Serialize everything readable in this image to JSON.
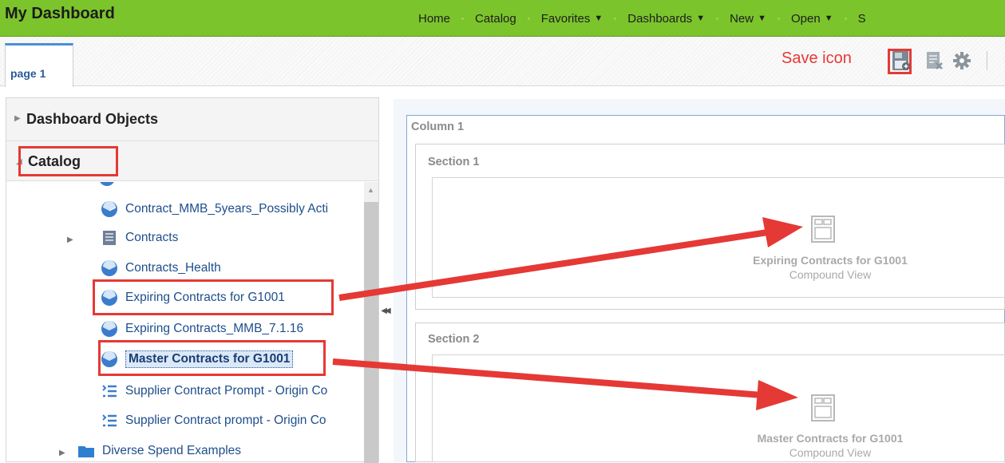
{
  "app": {
    "title": "My Dashboard"
  },
  "nav": [
    {
      "label": "Home",
      "caret": ""
    },
    {
      "label": "Catalog",
      "caret": ""
    },
    {
      "label": "Favorites",
      "caret": "▼"
    },
    {
      "label": "Dashboards",
      "caret": "▼"
    },
    {
      "label": "New",
      "caret": "▼"
    },
    {
      "label": "Open",
      "caret": "▼"
    },
    {
      "label": "S",
      "caret": ""
    }
  ],
  "tabs": [
    {
      "label": "page 1"
    }
  ],
  "annotation": {
    "save_callout": "Save icon"
  },
  "toolbar": {
    "icons": [
      "save-icon",
      "discard-icon",
      "settings-icon"
    ]
  },
  "left_panel": {
    "sections": [
      {
        "label": "Dashboard Objects",
        "expanded": false
      },
      {
        "label": "Catalog",
        "expanded": true
      }
    ],
    "tree": [
      {
        "label": "Contract_MMB_5years_Possibly Acti",
        "icon": "analysis-icon",
        "expandable": false
      },
      {
        "label": "Contracts",
        "icon": "subject-area-icon",
        "expandable": true
      },
      {
        "label": "Contracts_Health",
        "icon": "analysis-icon",
        "expandable": false
      },
      {
        "label": "Expiring Contracts for G1001",
        "icon": "analysis-icon",
        "expandable": false,
        "highlighted": true
      },
      {
        "label": "Expiring Contracts_MMB_7.1.16",
        "icon": "analysis-icon",
        "expandable": false
      },
      {
        "label": "Master Contracts for G1001",
        "icon": "analysis-icon",
        "expandable": false,
        "highlighted": true,
        "selected": true
      },
      {
        "label": "Supplier Contract Prompt - Origin Co",
        "icon": "prompt-icon",
        "expandable": false
      },
      {
        "label": "Supplier Contract prompt - Origin Co",
        "icon": "prompt-icon",
        "expandable": false
      },
      {
        "label": "Diverse Spend Examples",
        "icon": "folder-icon",
        "expandable": true
      }
    ]
  },
  "canvas": {
    "column_title": "Column 1",
    "sections": [
      {
        "title": "Section 1",
        "view_name": "Expiring Contracts for G1001",
        "view_type": "Compound View"
      },
      {
        "title": "Section 2",
        "view_name": "Master Contracts for G1001",
        "view_type": "Compound View"
      }
    ]
  },
  "colors": {
    "header_green": "#7cc42c",
    "annotation_red": "#e53935",
    "link_blue": "#1e4e8c"
  }
}
